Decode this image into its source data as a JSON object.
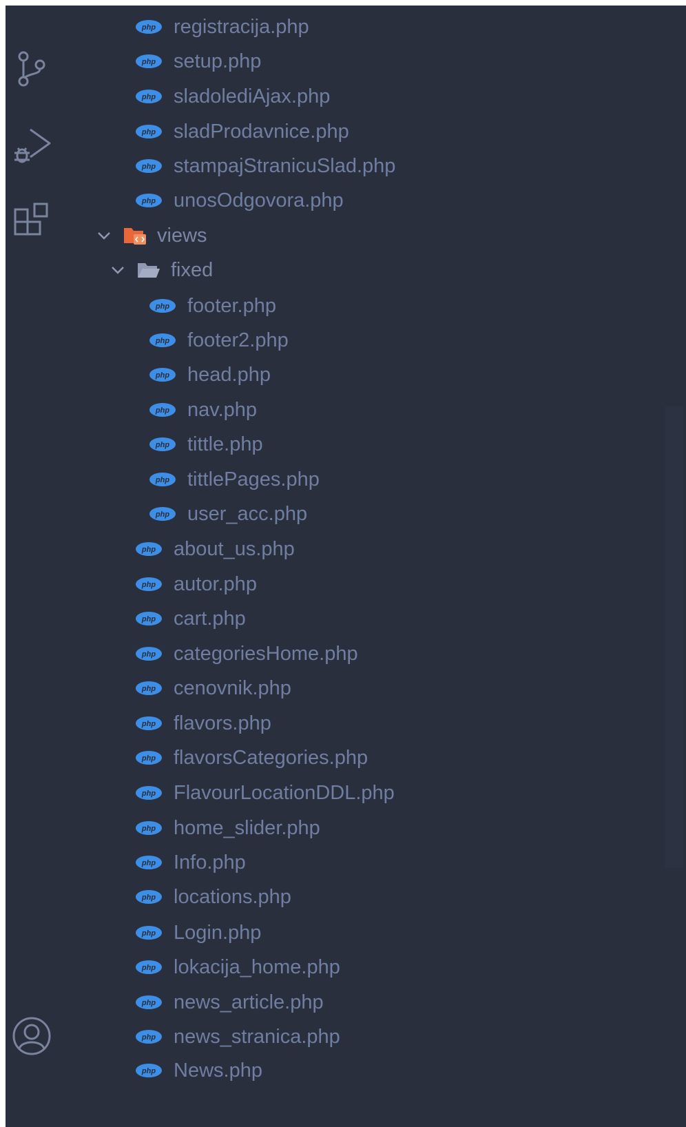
{
  "colors": {
    "background": "#2a2f3e",
    "text": "#6f7ea1",
    "php_icon": "#3d8ee6",
    "folder_views": "#e8683a",
    "folder_fixed": "#8f99b3",
    "activity_icon": "#7a849e"
  },
  "activity_bar": {
    "icons": [
      "source-control-icon",
      "run-debug-icon",
      "extensions-icon",
      "account-icon"
    ]
  },
  "tree": {
    "top_files": [
      "registracija.php",
      "setup.php",
      "sladolediAjax.php",
      "sladProdavnice.php",
      "stampajStranicuSlad.php",
      "unosOdgovora.php"
    ],
    "views_folder": "views",
    "fixed_folder": "fixed",
    "fixed_files": [
      "footer.php",
      "footer2.php",
      "head.php",
      "nav.php",
      "tittle.php",
      "tittlePages.php",
      "user_acc.php"
    ],
    "views_files": [
      "about_us.php",
      "autor.php",
      "cart.php",
      "categoriesHome.php",
      "cenovnik.php",
      "flavors.php",
      "flavorsCategories.php",
      "FlavourLocationDDL.php",
      "home_slider.php",
      "Info.php",
      "locations.php",
      "Login.php",
      "lokacija_home.php",
      "news_article.php",
      "news_stranica.php",
      "News.php"
    ]
  }
}
